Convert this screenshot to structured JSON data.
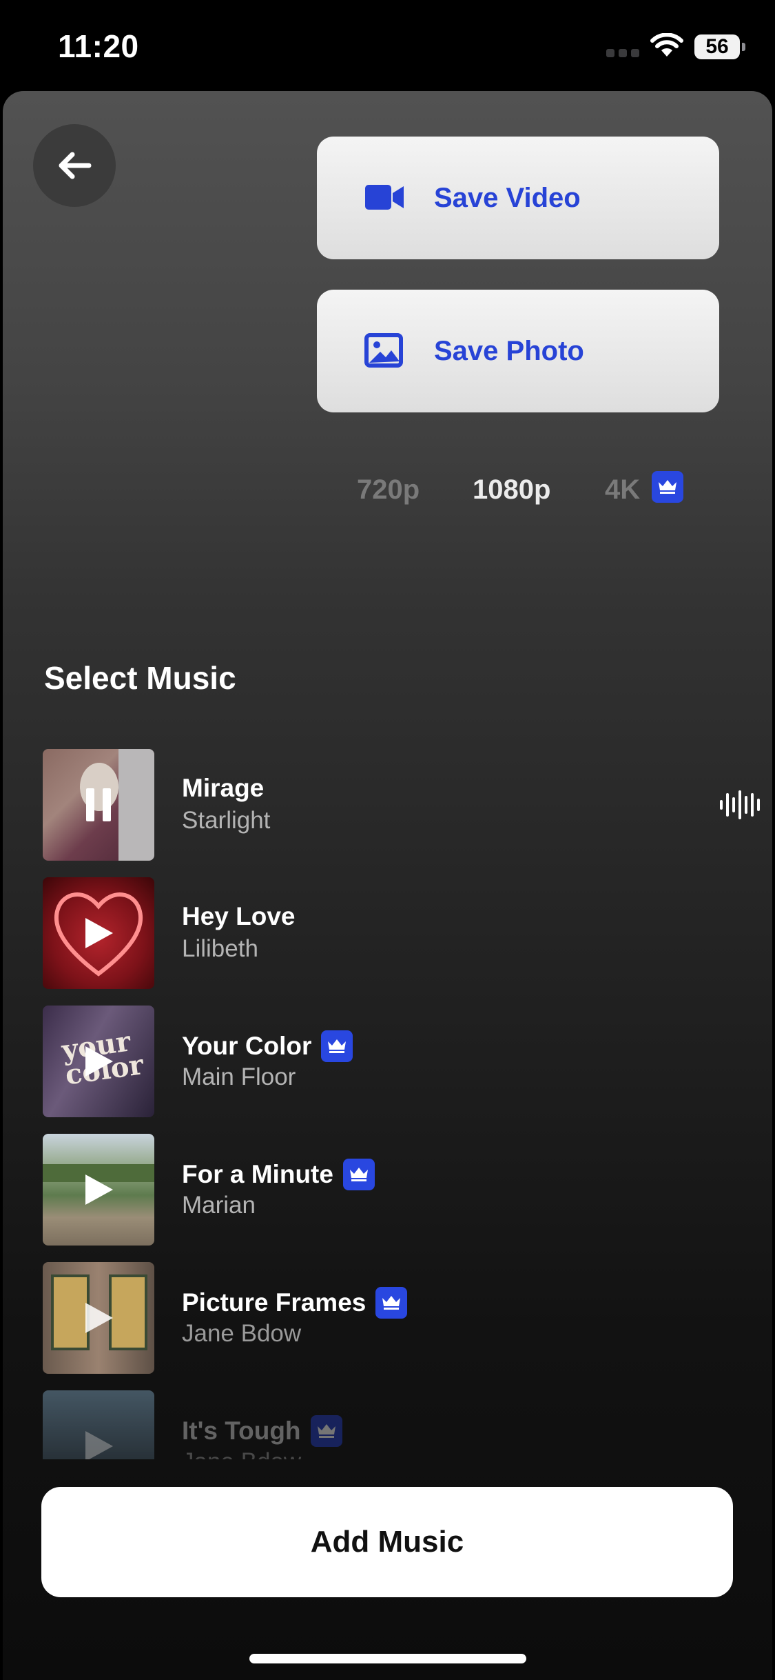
{
  "status_bar": {
    "time": "11:20",
    "battery": "56"
  },
  "actions": {
    "save_video_label": "Save Video",
    "save_photo_label": "Save Photo"
  },
  "resolutions": [
    {
      "label": "720p",
      "selected": false
    },
    {
      "label": "1080p",
      "selected": true
    },
    {
      "label": "4K",
      "selected": false,
      "premium": true
    }
  ],
  "music": {
    "title": "Select Music",
    "tracks": [
      {
        "title": "Mirage",
        "artist": "Starlight",
        "state": "playing",
        "premium": false
      },
      {
        "title": "Hey Love",
        "artist": "Lilibeth",
        "state": "paused",
        "premium": false
      },
      {
        "title": "Your Color",
        "artist": "Main Floor",
        "state": "paused",
        "premium": true
      },
      {
        "title": "For a Minute",
        "artist": "Marian",
        "state": "paused",
        "premium": true
      },
      {
        "title": "Picture Frames",
        "artist": "Jane Bdow",
        "state": "paused",
        "premium": true
      },
      {
        "title": "It's Tough",
        "artist": "Jane Bdow",
        "state": "paused",
        "premium": true
      }
    ]
  },
  "footer": {
    "add_music_label": "Add Music"
  },
  "colors": {
    "accent": "#2743d6",
    "badge": "#2947e0",
    "sheet_top": "#525252",
    "sheet_bottom": "#0c0c0c"
  }
}
